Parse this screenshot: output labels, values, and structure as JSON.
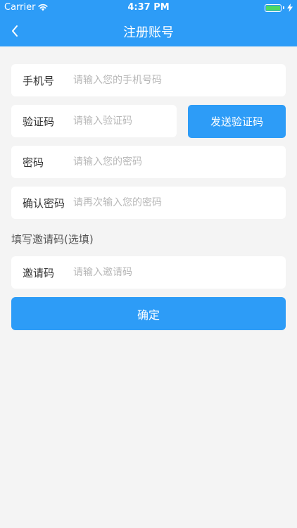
{
  "status_bar": {
    "carrier": "Carrier",
    "time": "4:37 PM"
  },
  "nav": {
    "title": "注册账号",
    "back_icon": "chevron-left-icon"
  },
  "form": {
    "phone": {
      "label": "手机号",
      "placeholder": "请输入您的手机号码",
      "value": ""
    },
    "code": {
      "label": "验证码",
      "placeholder": "请输入验证码",
      "value": ""
    },
    "send_code_label": "发送验证码",
    "password": {
      "label": "密码",
      "placeholder": "请输入您的密码",
      "value": ""
    },
    "confirm_password": {
      "label": "确认密码",
      "placeholder": "请再次输入您的密码",
      "value": ""
    },
    "invite_section_label": "填写邀请码(选填)",
    "invite": {
      "label": "邀请码",
      "placeholder": "请输入邀请码",
      "value": ""
    },
    "confirm_label": "确定"
  },
  "colors": {
    "primary": "#2d9cf7",
    "background": "#f4f4f4",
    "battery": "#4cd964"
  },
  "battery_level": 1.0
}
